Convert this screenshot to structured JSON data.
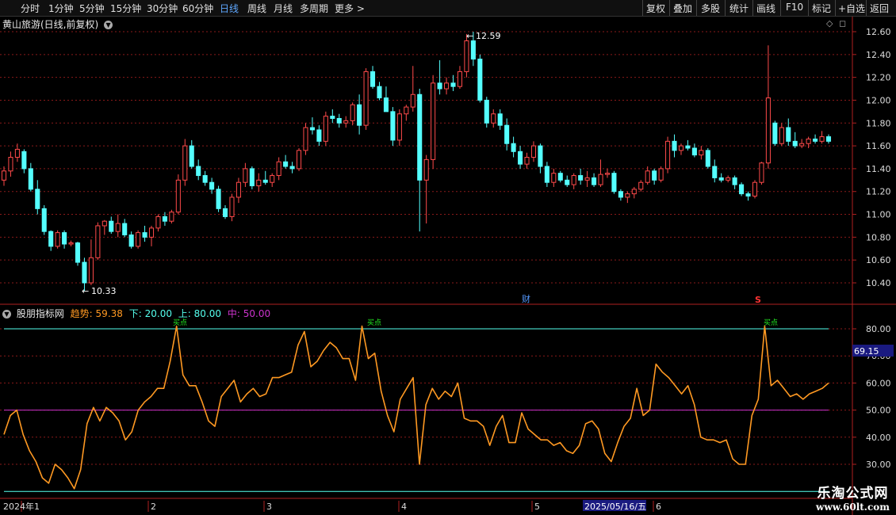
{
  "toolbar": {
    "periods": [
      "分时",
      "1分钟",
      "5分钟",
      "15分钟",
      "30分钟",
      "60分钟",
      "日线",
      "周线",
      "月线",
      "多周期",
      "更多 >"
    ],
    "active_period": "日线",
    "right_buttons": [
      "复权",
      "叠加",
      "多股",
      "统计",
      "画线",
      "F10",
      "+自选",
      "返回"
    ],
    "mark_label": "标记"
  },
  "title": "黄山旅游(日线,前复权)",
  "price_axis_labels": [
    "12.60",
    "12.40",
    "12.20",
    "12.00",
    "11.80",
    "11.60",
    "11.40",
    "11.20",
    "11.00",
    "10.80",
    "10.60",
    "10.40"
  ],
  "annotations": {
    "high": "12.59",
    "low": "10.33",
    "fin_marker": "财",
    "s_marker": "S",
    "buy_label": "买点"
  },
  "indicator": {
    "name": "股朋指标网",
    "trend_label": "趋势:",
    "trend_value": "59.38",
    "low_label": "下:",
    "low_value": "20.00",
    "high_label": "上:",
    "high_value": "80.00",
    "mid_label": "中:",
    "mid_value": "50.00",
    "axis_labels": [
      "80.00",
      "70.00",
      "60.00",
      "50.00",
      "40.00",
      "30.00"
    ],
    "current_badge": "69.15"
  },
  "date_axis": {
    "labels": [
      "2024年1",
      "2",
      "3",
      "4",
      "5",
      "2025/05/16/五",
      "6"
    ]
  },
  "watermark": {
    "line1": "乐淘公式网",
    "line2": "www.60lt.com"
  },
  "chart_data": [
    {
      "type": "candlestick",
      "title": "黄山旅游(日线,前复权)",
      "ylim": [
        10.25,
        12.75
      ],
      "up_color": "#ff4a4a",
      "down_color": "#54ffff",
      "ohlc": [
        [
          11.3,
          11.42,
          11.25,
          11.38
        ],
        [
          11.38,
          11.55,
          11.33,
          11.5
        ],
        [
          11.5,
          11.62,
          11.46,
          11.57
        ],
        [
          11.55,
          11.57,
          11.36,
          11.4
        ],
        [
          11.4,
          11.45,
          11.2,
          11.22
        ],
        [
          11.22,
          11.3,
          11.0,
          11.05
        ],
        [
          11.05,
          11.08,
          10.82,
          10.85
        ],
        [
          10.85,
          10.86,
          10.68,
          10.72
        ],
        [
          10.72,
          10.86,
          10.7,
          10.84
        ],
        [
          10.84,
          10.86,
          10.7,
          10.74
        ],
        [
          10.74,
          10.77,
          10.72,
          10.75
        ],
        [
          10.75,
          10.76,
          10.55,
          10.58
        ],
        [
          10.58,
          10.62,
          10.33,
          10.4
        ],
        [
          10.4,
          10.78,
          10.38,
          10.62
        ],
        [
          10.62,
          10.93,
          10.6,
          10.9
        ],
        [
          10.9,
          10.95,
          10.82,
          10.94
        ],
        [
          10.94,
          10.98,
          10.83,
          10.85
        ],
        [
          10.85,
          11.0,
          10.8,
          10.92
        ],
        [
          10.92,
          10.96,
          10.8,
          10.82
        ],
        [
          10.82,
          10.85,
          10.7,
          10.72
        ],
        [
          10.72,
          10.86,
          10.7,
          10.84
        ],
        [
          10.84,
          10.9,
          10.76,
          10.8
        ],
        [
          10.8,
          10.9,
          10.72,
          10.88
        ],
        [
          10.88,
          11.0,
          10.85,
          10.98
        ],
        [
          10.98,
          11.02,
          10.9,
          10.94
        ],
        [
          10.94,
          11.04,
          10.92,
          11.02
        ],
        [
          11.02,
          11.35,
          11.0,
          11.3
        ],
        [
          11.3,
          11.66,
          11.25,
          11.6
        ],
        [
          11.6,
          11.65,
          11.4,
          11.42
        ],
        [
          11.42,
          11.48,
          11.3,
          11.34
        ],
        [
          11.34,
          11.38,
          11.25,
          11.28
        ],
        [
          11.28,
          11.32,
          11.18,
          11.22
        ],
        [
          11.22,
          11.25,
          11.02,
          11.05
        ],
        [
          11.05,
          11.08,
          10.96,
          10.98
        ],
        [
          10.98,
          11.18,
          10.94,
          11.15
        ],
        [
          11.15,
          11.32,
          11.1,
          11.28
        ],
        [
          11.28,
          11.45,
          11.24,
          11.4
        ],
        [
          11.4,
          11.42,
          11.22,
          11.25
        ],
        [
          11.25,
          11.36,
          11.2,
          11.3
        ],
        [
          11.3,
          11.38,
          11.26,
          11.28
        ],
        [
          11.28,
          11.36,
          11.24,
          11.34
        ],
        [
          11.34,
          11.5,
          11.3,
          11.46
        ],
        [
          11.46,
          11.52,
          11.4,
          11.42
        ],
        [
          11.42,
          11.46,
          11.36,
          11.4
        ],
        [
          11.4,
          11.58,
          11.38,
          11.56
        ],
        [
          11.56,
          11.8,
          11.52,
          11.76
        ],
        [
          11.76,
          11.85,
          11.7,
          11.74
        ],
        [
          11.74,
          11.78,
          11.6,
          11.64
        ],
        [
          11.64,
          11.9,
          11.6,
          11.86
        ],
        [
          11.86,
          11.92,
          11.8,
          11.84
        ],
        [
          11.84,
          11.88,
          11.76,
          11.8
        ],
        [
          11.8,
          11.86,
          11.76,
          11.82
        ],
        [
          11.82,
          11.98,
          11.78,
          11.96
        ],
        [
          11.96,
          12.05,
          11.7,
          11.78
        ],
        [
          11.78,
          12.28,
          11.74,
          12.25
        ],
        [
          12.25,
          12.3,
          12.1,
          12.12
        ],
        [
          12.12,
          12.16,
          12.0,
          12.02
        ],
        [
          12.02,
          12.12,
          11.98,
          11.9
        ],
        [
          11.9,
          11.94,
          11.6,
          11.65
        ],
        [
          11.65,
          11.92,
          11.6,
          11.88
        ],
        [
          11.88,
          11.96,
          11.82,
          11.94
        ],
        [
          11.94,
          12.3,
          11.9,
          12.05
        ],
        [
          12.05,
          12.1,
          10.85,
          11.3
        ],
        [
          11.3,
          11.52,
          10.92,
          11.48
        ],
        [
          11.48,
          12.22,
          11.4,
          12.15
        ],
        [
          12.15,
          12.35,
          12.05,
          12.1
        ],
        [
          12.1,
          12.2,
          12.05,
          12.15
        ],
        [
          12.15,
          12.22,
          12.08,
          12.12
        ],
        [
          12.12,
          12.3,
          12.1,
          12.25
        ],
        [
          12.25,
          12.58,
          12.2,
          12.52
        ],
        [
          12.52,
          12.6,
          12.3,
          12.36
        ],
        [
          12.36,
          12.4,
          11.98,
          12.0
        ],
        [
          12.0,
          12.03,
          11.76,
          11.8
        ],
        [
          11.8,
          11.92,
          11.76,
          11.88
        ],
        [
          11.88,
          11.92,
          11.74,
          11.78
        ],
        [
          11.78,
          11.84,
          11.56,
          11.62
        ],
        [
          11.62,
          11.68,
          11.5,
          11.55
        ],
        [
          11.55,
          11.6,
          11.4,
          11.44
        ],
        [
          11.44,
          11.54,
          11.4,
          11.5
        ],
        [
          11.5,
          11.64,
          11.46,
          11.6
        ],
        [
          11.6,
          11.62,
          11.36,
          11.42
        ],
        [
          11.42,
          11.46,
          11.24,
          11.28
        ],
        [
          11.28,
          11.4,
          11.24,
          11.36
        ],
        [
          11.36,
          11.38,
          11.28,
          11.3
        ],
        [
          11.3,
          11.34,
          11.24,
          11.26
        ],
        [
          11.26,
          11.36,
          11.22,
          11.34
        ],
        [
          11.34,
          11.4,
          11.26,
          11.3
        ],
        [
          11.3,
          11.38,
          11.24,
          11.32
        ],
        [
          11.32,
          11.36,
          11.24,
          11.26
        ],
        [
          11.26,
          11.48,
          11.24,
          11.35
        ],
        [
          11.35,
          11.4,
          11.32,
          11.36
        ],
        [
          11.36,
          11.38,
          11.18,
          11.2
        ],
        [
          11.2,
          11.22,
          11.12,
          11.15
        ],
        [
          11.15,
          11.2,
          11.1,
          11.18
        ],
        [
          11.18,
          11.24,
          11.14,
          11.22
        ],
        [
          11.22,
          11.3,
          11.2,
          11.28
        ],
        [
          11.28,
          11.42,
          11.26,
          11.38
        ],
        [
          11.38,
          11.4,
          11.26,
          11.3
        ],
        [
          11.3,
          11.42,
          11.28,
          11.4
        ],
        [
          11.4,
          11.68,
          11.36,
          11.64
        ],
        [
          11.64,
          11.7,
          11.5,
          11.56
        ],
        [
          11.56,
          11.62,
          11.52,
          11.6
        ],
        [
          11.6,
          11.65,
          11.56,
          11.58
        ],
        [
          11.58,
          11.62,
          11.5,
          11.52
        ],
        [
          11.52,
          11.6,
          11.48,
          11.56
        ],
        [
          11.56,
          11.58,
          11.4,
          11.42
        ],
        [
          11.42,
          11.48,
          11.28,
          11.32
        ],
        [
          11.32,
          11.36,
          11.28,
          11.3
        ],
        [
          11.3,
          11.34,
          11.28,
          11.32
        ],
        [
          11.32,
          11.34,
          11.22,
          11.26
        ],
        [
          11.26,
          11.28,
          11.16,
          11.18
        ],
        [
          11.18,
          11.2,
          11.12,
          11.16
        ],
        [
          11.16,
          11.3,
          11.14,
          11.28
        ],
        [
          11.28,
          11.46,
          11.26,
          11.45
        ],
        [
          11.45,
          12.48,
          11.4,
          12.02
        ],
        [
          11.8,
          11.82,
          11.6,
          11.62
        ],
        [
          11.62,
          11.8,
          11.6,
          11.76
        ],
        [
          11.76,
          11.84,
          11.6,
          11.64
        ],
        [
          11.64,
          11.72,
          11.58,
          11.6
        ],
        [
          11.6,
          11.66,
          11.58,
          11.62
        ],
        [
          11.62,
          11.68,
          11.58,
          11.66
        ],
        [
          11.66,
          11.7,
          11.62,
          11.64
        ],
        [
          11.64,
          11.73,
          11.62,
          11.68
        ],
        [
          11.68,
          11.7,
          11.62,
          11.64
        ]
      ]
    },
    {
      "type": "line",
      "title": "股朋指标网",
      "ylim": [
        17,
        93
      ],
      "series": [
        {
          "name": "趋势",
          "color": "#ff9922",
          "values": [
            41,
            48,
            50,
            41,
            35,
            31,
            25,
            23,
            30,
            28,
            25,
            21,
            28,
            45,
            51,
            46,
            51,
            49,
            46,
            39,
            42,
            50,
            53,
            55,
            58,
            58,
            68,
            81,
            63,
            59,
            59,
            53,
            46,
            44,
            55,
            58,
            61,
            53,
            56,
            58,
            55,
            56,
            62,
            62,
            63,
            64,
            74,
            79,
            66,
            68,
            72,
            75,
            73,
            69,
            69,
            61,
            81,
            69,
            71,
            57,
            48,
            42,
            54,
            58,
            62,
            30,
            52,
            58,
            54,
            57,
            55,
            60,
            47,
            46,
            46,
            44,
            37,
            44,
            48,
            38,
            38,
            49,
            43,
            41,
            39,
            39,
            37,
            38,
            35,
            34,
            37,
            45,
            46,
            43,
            34,
            31,
            38,
            44,
            47,
            58,
            48,
            50,
            67,
            64,
            62,
            59,
            56,
            59,
            52,
            40,
            39,
            39,
            38,
            39,
            32,
            30,
            30,
            48,
            54,
            81,
            59,
            61,
            58,
            55,
            56,
            54,
            56,
            57,
            58,
            60
          ]
        },
        {
          "name": "下",
          "color": "#55ffee",
          "values": [
            20
          ]
        },
        {
          "name": "上",
          "color": "#55ffee",
          "values": [
            80
          ]
        },
        {
          "name": "中",
          "color": "#cc33cc",
          "values": [
            50
          ]
        }
      ]
    }
  ]
}
